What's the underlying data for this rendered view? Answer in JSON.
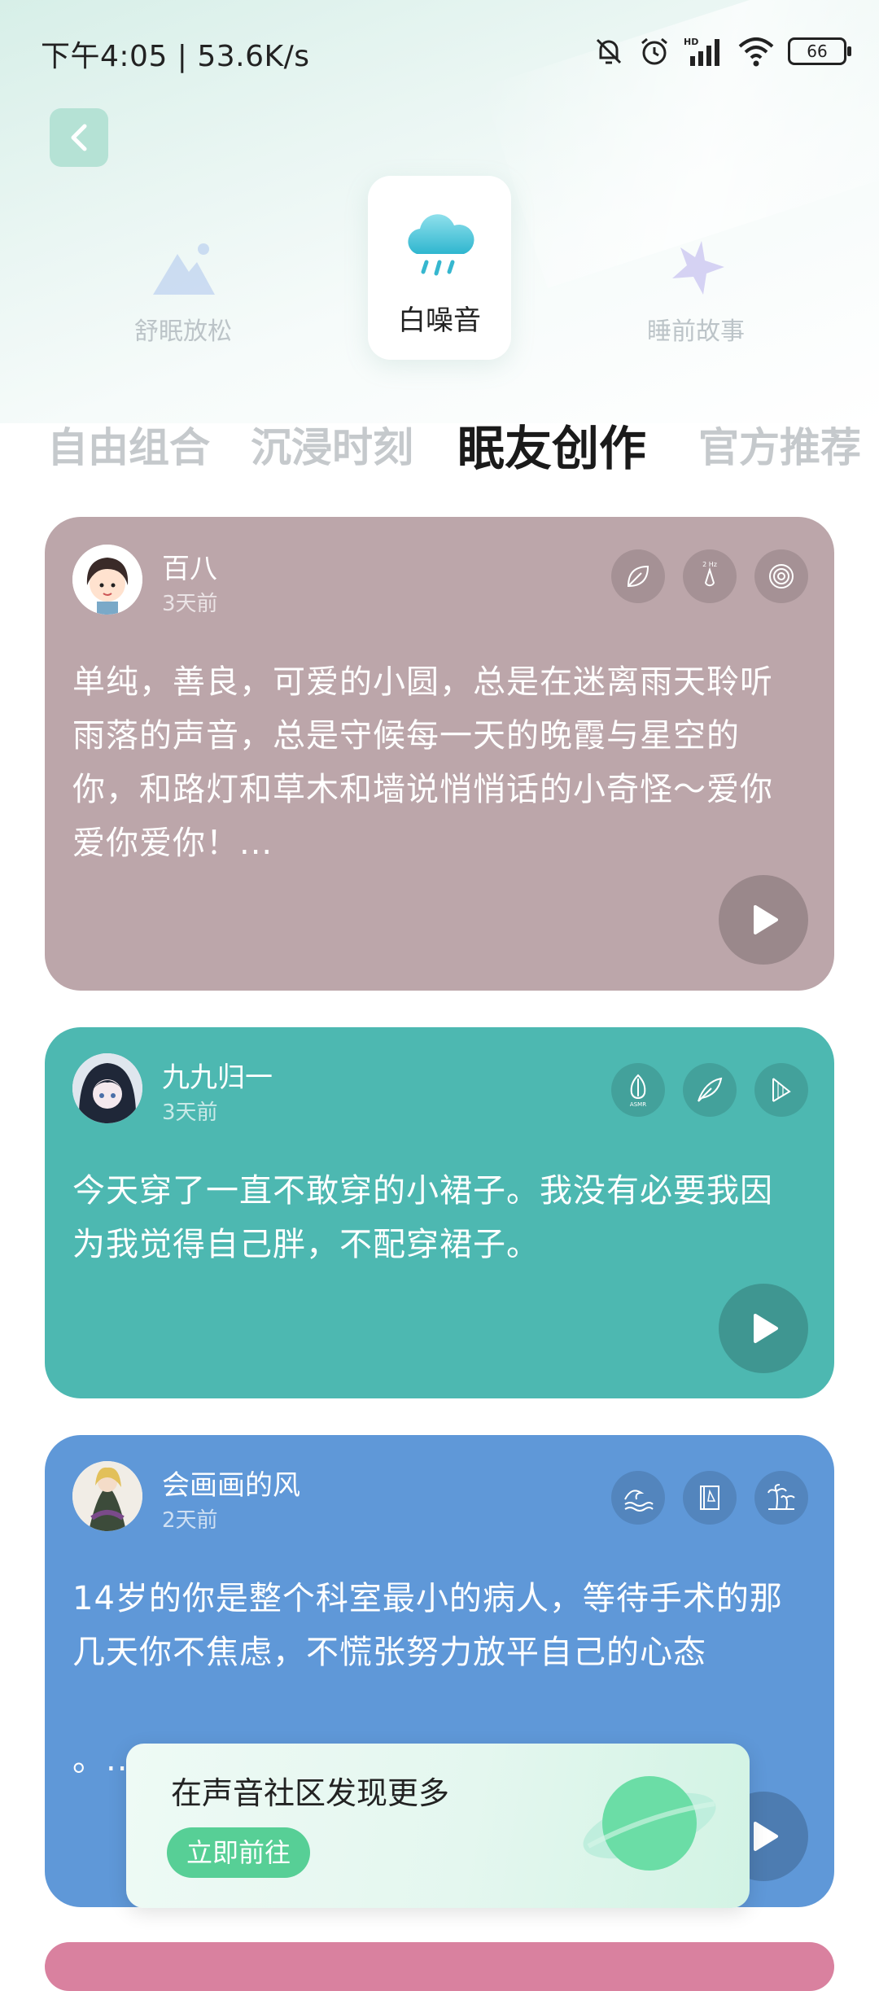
{
  "status_bar": {
    "time_speed": "下午4:05 | 53.6K/s",
    "battery": "66"
  },
  "categories": [
    {
      "label": "舒眠放松",
      "icon": "mountain-icon"
    },
    {
      "label": "白噪音",
      "icon": "rain-cloud-icon",
      "active": true
    },
    {
      "label": "睡前故事",
      "icon": "star-icon"
    }
  ],
  "tabs": [
    "自由组合",
    "沉浸时刻",
    "眠友创作",
    "官方推荐"
  ],
  "active_tab": "眠友创作",
  "cards": [
    {
      "user": "百八",
      "time": "3天前",
      "color": "#bca6aa",
      "text": "单纯，善良，可爱的小圆，总是在迷离雨天聆听雨落的声音，总是守候每一天的晚霞与星空的你，和路灯和草木和墙说悄悄话的小奇怪～爱你爱你爱你！...",
      "sound_icons": [
        "leaf-icon",
        "2hz-drop-icon",
        "spiral-icon"
      ],
      "sound_labels": [
        "",
        "2 Hz",
        ""
      ]
    },
    {
      "user": "九九归一",
      "time": "3天前",
      "color": "#4db8b1",
      "text": "今天穿了一直不敢穿的小裙子。我没有必要我因为我觉得自己胖，不配穿裙子。",
      "sound_icons": [
        "asmr-icon",
        "feather-icon",
        "harp-icon"
      ],
      "sound_labels": [
        "ASMR",
        "",
        ""
      ]
    },
    {
      "user": "会画画的风",
      "time": "2天前",
      "color": "#5f98d8",
      "text": " 14岁的你是整个科室最小的病人，等待手术的那几天你不焦虑，不慌张努力放平自己的心态",
      "text_more": "。..",
      "sound_icons": [
        "waves-icon",
        "book-icon",
        "palm-tree-icon"
      ],
      "sound_labels": [
        "",
        "",
        ""
      ]
    }
  ],
  "banner": {
    "title": "在声音社区发现更多",
    "button": "立即前往"
  },
  "colors": {
    "accent": "#57cf96",
    "back_button": "#b5e2d5",
    "card4_peek": "#d9819f"
  }
}
